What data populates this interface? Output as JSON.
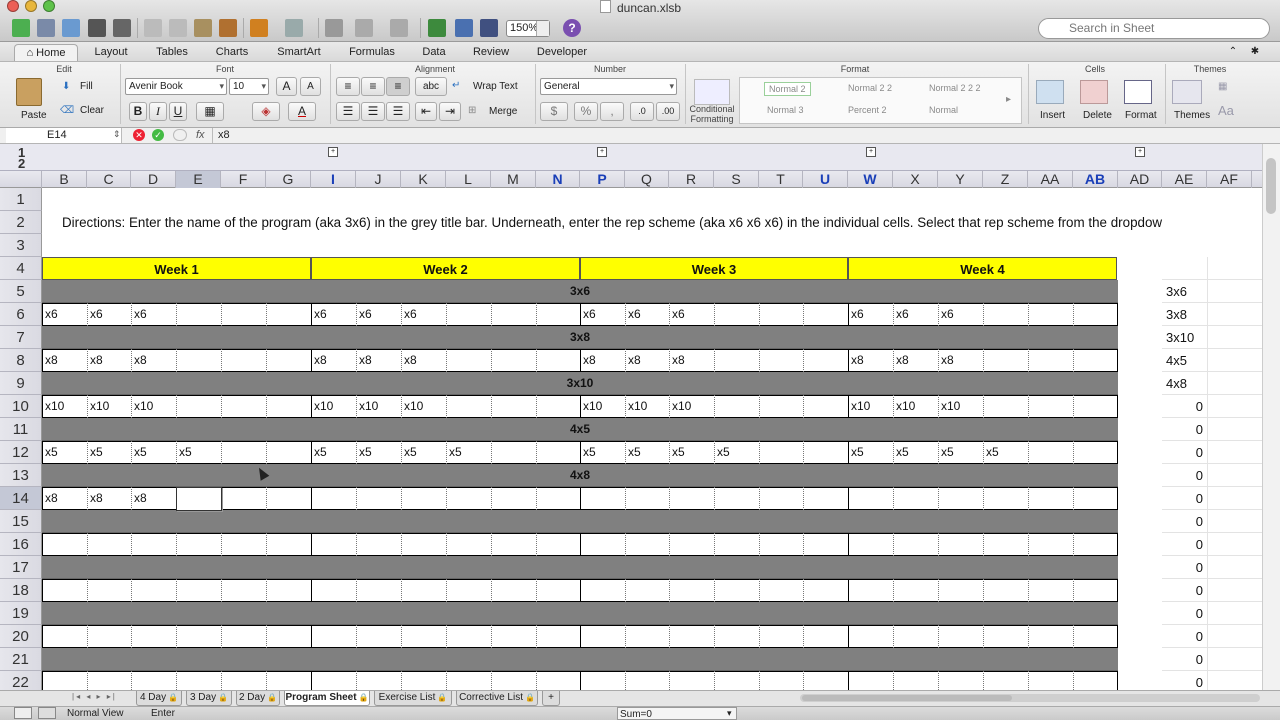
{
  "window": {
    "title": "duncan.xlsb"
  },
  "toolbar": {
    "zoom": "150%",
    "search_placeholder": "Search in Sheet"
  },
  "ribbon_tabs": [
    "Home",
    "Layout",
    "Tables",
    "Charts",
    "SmartArt",
    "Formulas",
    "Data",
    "Review",
    "Developer"
  ],
  "ribbon": {
    "groups": {
      "edit": "Edit",
      "font": "Font",
      "alignment": "Alignment",
      "number": "Number",
      "format": "Format",
      "cells": "Cells",
      "themes": "Themes"
    },
    "paste": "Paste",
    "fill": "Fill",
    "clear": "Clear",
    "font_name": "Avenir Book",
    "font_size": "10",
    "bold": "B",
    "italic": "I",
    "underline": "U",
    "font_color": "A",
    "orientation": "abc",
    "wrap_text": "Wrap Text",
    "merge": "Merge",
    "number_format": "General",
    "conditional_formatting": "Conditional Formatting",
    "styles": [
      "Normal 2",
      "Normal 2 2",
      "Normal 2 2 2",
      "Normal 3",
      "Percent 2",
      "Normal"
    ],
    "insert": "Insert",
    "delete": "Delete",
    "format_btn": "Format",
    "themes_btn": "Themes"
  },
  "formula_bar": {
    "name_box": "E14",
    "fx": "fx",
    "value": "x8"
  },
  "outline_levels": [
    "1",
    "2"
  ],
  "columns": [
    "B",
    "C",
    "D",
    "E",
    "F",
    "G",
    "I",
    "J",
    "K",
    "L",
    "M",
    "N",
    "P",
    "Q",
    "R",
    "S",
    "T",
    "U",
    "W",
    "X",
    "Y",
    "Z",
    "AA",
    "AB",
    "AD",
    "AE",
    "AF"
  ],
  "directions": "Directions: Enter the name of the program (aka 3x6) in the grey title bar.  Underneath, enter the rep scheme (aka x6 x6 x6) in the individual cells.  Select that rep scheme from the dropdow",
  "weeks": [
    "Week 1",
    "Week 2",
    "Week 3",
    "Week 4"
  ],
  "row_numbers": [
    "1",
    "2",
    "3",
    "4",
    "5",
    "6",
    "7",
    "8",
    "9",
    "10",
    "11",
    "12",
    "13",
    "14",
    "15",
    "16",
    "17",
    "18",
    "19",
    "20",
    "21",
    "22"
  ],
  "programs": [
    {
      "title": "3x6",
      "reps": [
        "x6",
        "x6",
        "x6"
      ]
    },
    {
      "title": "3x8",
      "reps": [
        "x8",
        "x8",
        "x8"
      ]
    },
    {
      "title": "3x10",
      "reps": [
        "x10",
        "x10",
        "x10"
      ]
    },
    {
      "title": "4x5",
      "reps": [
        "x5",
        "x5",
        "x5",
        "x5"
      ]
    },
    {
      "title": "4x8",
      "reps": [
        "x8",
        "x8",
        "x8",
        "x8"
      ]
    }
  ],
  "ae_column": [
    "3x6",
    "3x8",
    "3x10",
    "4x5",
    "4x8",
    "0",
    "0",
    "0",
    "0",
    "0",
    "0",
    "0",
    "0",
    "0",
    "0",
    "0",
    "0",
    "0"
  ],
  "active_cell": {
    "ref": "E14",
    "value": "x8"
  },
  "sheet_tabs": [
    "4 Day",
    "3 Day",
    "2 Day",
    "Program Sheet",
    "Exercise List",
    "Corrective List",
    "+"
  ],
  "active_sheet": "Program Sheet",
  "status": {
    "view": "Normal View",
    "mode": "Enter",
    "sum": "Sum=0"
  },
  "colors": {
    "week_header": "#ffff00",
    "title_bar": "#808080",
    "active_tab": "#ffffff"
  }
}
